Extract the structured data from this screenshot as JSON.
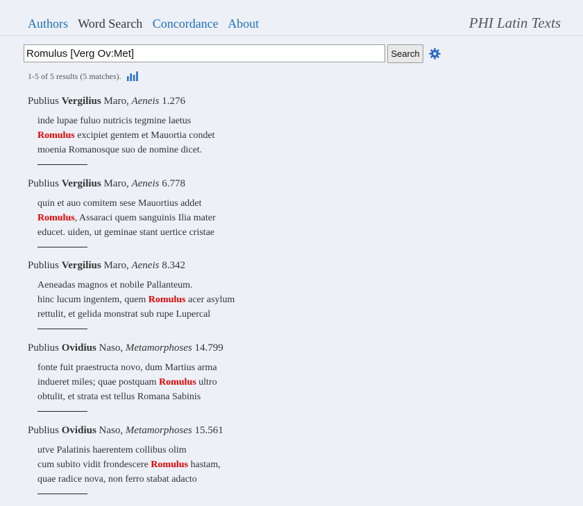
{
  "nav": {
    "items": [
      {
        "label": "Authors",
        "active": false
      },
      {
        "label": "Word Search",
        "active": true
      },
      {
        "label": "Concordance",
        "active": false
      },
      {
        "label": "About",
        "active": false
      }
    ],
    "site_title": "PHI Latin Texts"
  },
  "search": {
    "value": "Romulus [Verg Ov:Met]",
    "button_label": "Search",
    "settings_icon": "gear-icon"
  },
  "status": {
    "text": "1-5 of 5 results (5 matches).",
    "stats_icon": "bar-chart-icon"
  },
  "colors": {
    "link": "#1f6fb8",
    "hit": "#e00000",
    "background": "#edf1f7"
  },
  "results": [
    {
      "praenomen": "Publius",
      "nomen": "Vergilius",
      "cognomen": "Maro,",
      "work": "Aeneis",
      "ref": "1.276",
      "lines": [
        {
          "before": "inde lupae fuluo nutricis tegmine laetus",
          "hit": "",
          "after": ""
        },
        {
          "before": "",
          "hit": "Romulus",
          "after": " excipiet gentem et Mauortia condet"
        },
        {
          "before": "moenia Romanosque suo de nomine dicet.",
          "hit": "",
          "after": ""
        }
      ]
    },
    {
      "praenomen": "Publius",
      "nomen": "Vergilius",
      "cognomen": "Maro,",
      "work": "Aeneis",
      "ref": "6.778",
      "lines": [
        {
          "before": "quin et auo comitem sese Mauortius addet",
          "hit": "",
          "after": ""
        },
        {
          "before": "",
          "hit": "Romulus",
          "after": ", Assaraci quem sanguinis Ilia mater"
        },
        {
          "before": "educet. uiden, ut geminae stant uertice cristae",
          "hit": "",
          "after": ""
        }
      ]
    },
    {
      "praenomen": "Publius",
      "nomen": "Vergilius",
      "cognomen": "Maro,",
      "work": "Aeneis",
      "ref": "8.342",
      "lines": [
        {
          "before": "Aeneadas magnos et nobile Pallanteum.",
          "hit": "",
          "after": ""
        },
        {
          "before": "hinc lucum ingentem, quem ",
          "hit": "Romulus",
          "after": " acer asylum"
        },
        {
          "before": "rettulit, et gelida monstrat sub rupe Lupercal",
          "hit": "",
          "after": ""
        }
      ]
    },
    {
      "praenomen": "Publius",
      "nomen": "Ovidius",
      "cognomen": "Naso,",
      "work": "Metamorphoses",
      "ref": "14.799",
      "lines": [
        {
          "before": "fonte fuit praestructa novo, dum Martius arma",
          "hit": "",
          "after": ""
        },
        {
          "before": "indueret miles; quae postquam ",
          "hit": "Romulus",
          "after": " ultro"
        },
        {
          "before": "obtulit, et strata est tellus Romana Sabinis",
          "hit": "",
          "after": ""
        }
      ]
    },
    {
      "praenomen": "Publius",
      "nomen": "Ovidius",
      "cognomen": "Naso,",
      "work": "Metamorphoses",
      "ref": "15.561",
      "lines": [
        {
          "before": "utve Palatinis haerentem collibus olim",
          "hit": "",
          "after": ""
        },
        {
          "before": "cum subito vidit frondescere ",
          "hit": "Romulus",
          "after": " hastam,"
        },
        {
          "before": "quae radice nova, non ferro stabat adacto",
          "hit": "",
          "after": ""
        }
      ]
    }
  ]
}
